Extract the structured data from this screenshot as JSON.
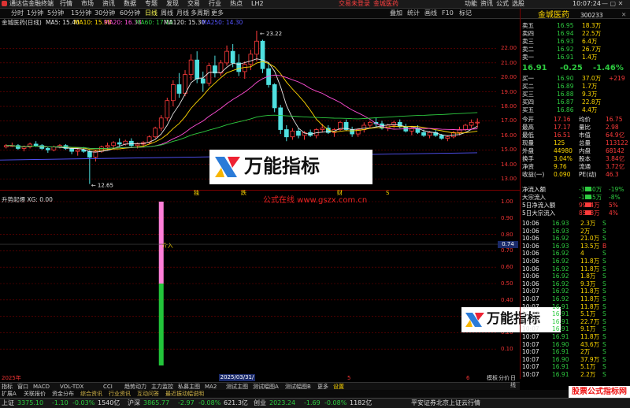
{
  "app": {
    "title": "通达信金融终端",
    "clock": "10:07:24"
  },
  "menu": [
    "行情",
    "市场",
    "资讯",
    "数据",
    "专题",
    "发现",
    "交易",
    "行业",
    "热点",
    "LH2"
  ],
  "menu_right": [
    "交易未登录",
    "金城医药"
  ],
  "menu_tail": [
    "功能",
    "资讯",
    "公式",
    "选股"
  ],
  "toolbar": [
    "分时",
    "1分钟",
    "5分钟",
    "15分钟",
    "30分钟",
    "60分钟",
    "日线",
    "周线",
    "月线",
    "多周期",
    "更多"
  ],
  "toolbar_right": [
    "叠加",
    "统计",
    "画线",
    "F10",
    "标记"
  ],
  "chart_title": "金城医药(日线)",
  "ma": [
    {
      "label": "MA5: 15.40",
      "color": "#e6e6e6"
    },
    {
      "label": "MA10: 15.98",
      "color": "#ffd800"
    },
    {
      "label": "MA20: 16.38",
      "color": "#ff4fd8"
    },
    {
      "label": "MA60: 17.19",
      "color": "#2ecc40"
    },
    {
      "label": "MA120: 15.30",
      "color": "#e6e6e6"
    },
    {
      "label": "MA250: 14.30",
      "color": "#5555ff"
    }
  ],
  "annotations": {
    "high": "23.22",
    "low": "12.65",
    "markers": [
      "独",
      "跌",
      "财",
      "S"
    ]
  },
  "price_axis": [
    "22.00",
    "21.00",
    "20.00",
    "19.00",
    "18.00",
    "17.00",
    "16.00",
    "15.00",
    "14.00",
    "13.00"
  ],
  "indicator": {
    "title": "升势起爆 XG: 0.00",
    "signal_label": "介入",
    "axis": [
      "1.00",
      "0.90",
      "0.80",
      "0.70",
      "0.60",
      "0.50",
      "0.40",
      "0.30",
      "0.20",
      "0.10"
    ],
    "cursor_value": "0.74"
  },
  "watermark": {
    "site": "公式在线 www.gszx.com.cn",
    "brand": "万能指标",
    "corner": "股票公式指标网"
  },
  "date_axis": {
    "left": "2025年",
    "cursor": "2025/03/31/一",
    "marks": [
      "5",
      "6"
    ]
  },
  "quote": {
    "name": "金城医药",
    "code": "300233",
    "price": "16.91",
    "change": "-0.25",
    "pct": "-1.46%",
    "asks": [
      [
        "卖五",
        "16.95",
        "18.3万"
      ],
      [
        "卖四",
        "16.94",
        "22.5万"
      ],
      [
        "卖三",
        "16.93",
        "6.4万"
      ],
      [
        "卖二",
        "16.92",
        "26.7万"
      ],
      [
        "卖一",
        "16.91",
        "1.4万"
      ]
    ],
    "bids": [
      [
        "买一",
        "16.90",
        "37.0万",
        "+219"
      ],
      [
        "买二",
        "16.89",
        "1.7万",
        ""
      ],
      [
        "买三",
        "16.88",
        "9.3万",
        ""
      ],
      [
        "买四",
        "16.87",
        "22.8万",
        ""
      ],
      [
        "买五",
        "16.86",
        "4.4万",
        ""
      ]
    ],
    "stats": [
      [
        "今开",
        "17.16",
        "均价",
        "16.75"
      ],
      [
        "最高",
        "17.17",
        "量比",
        "2.98"
      ],
      [
        "最低",
        "16.51",
        "市值",
        "64.9亿"
      ],
      [
        "现量",
        "125",
        "总量",
        "113122"
      ],
      [
        "外盘",
        "44980",
        "内盘",
        "68142"
      ],
      [
        "换手",
        "3.04%",
        "股本",
        "3.84亿"
      ],
      [
        "净资",
        "9.76",
        "流通",
        "3.72亿"
      ],
      [
        "收益(一)",
        "0.090",
        "PE(动)",
        "46.3"
      ]
    ],
    "flows": [
      [
        "净流入额",
        "-3640万",
        "-19%"
      ],
      [
        "大宗流入",
        "-1455万",
        "-8%"
      ],
      [
        "5日净流入额",
        "9924万",
        "5%"
      ],
      [
        "5日大宗流入",
        "8503万",
        "4%"
      ]
    ]
  },
  "ticks": [
    [
      "10:06",
      "16.93",
      "2.3万",
      "S"
    ],
    [
      "10:06",
      "16.93",
      "2万",
      "S"
    ],
    [
      "10:06",
      "16.92",
      "21.0万",
      "S"
    ],
    [
      "10:06",
      "16.93",
      "13.5万",
      "B"
    ],
    [
      "10:06",
      "16.92",
      "4",
      "S"
    ],
    [
      "10:06",
      "16.92",
      "11.8万",
      "S"
    ],
    [
      "10:06",
      "16.92",
      "11.8万",
      "S"
    ],
    [
      "10:06",
      "16.92",
      "1.8万",
      "S"
    ],
    [
      "10:06",
      "16.92",
      "9.3万",
      "S"
    ],
    [
      "10:07",
      "16.92",
      "11.8万",
      "S"
    ],
    [
      "10:07",
      "16.92",
      "11.8万",
      "S"
    ],
    [
      "10:07",
      "16.91",
      "11.8万",
      "S"
    ],
    [
      "10:07",
      "16.91",
      "5.1万",
      "S"
    ],
    [
      "10:07",
      "16.91",
      "22.7万",
      "S"
    ],
    [
      "10:07",
      "16.91",
      "9.1万",
      "S"
    ],
    [
      "10:07",
      "16.91",
      "11.8万",
      "S"
    ],
    [
      "10:07",
      "16.90",
      "43.6万",
      "S"
    ],
    [
      "10:07",
      "16.91",
      "2万",
      "S"
    ],
    [
      "10:07",
      "16.90",
      "37.9万",
      "S"
    ],
    [
      "10:07",
      "16.91",
      "5.1万",
      "S"
    ],
    [
      "10:07",
      "16.91",
      "2.2万",
      "S"
    ]
  ],
  "bottom_tabs": [
    "指标",
    "窗口",
    "MACD",
    "VOL-TDX",
    "CCI",
    "趋势动力",
    "主力监控",
    "私募主图",
    "MA2",
    "测试主图",
    "测试幅图A",
    "测试幅图B",
    "更多",
    "设置"
  ],
  "bottom_tabs2": [
    "扩展A",
    "关联报价",
    "资金分布",
    "综合资讯",
    "行业资讯",
    "互动问答",
    "最近振动幅说明"
  ],
  "right_tabs": [
    "模板",
    "分价",
    "日线"
  ],
  "status": [
    {
      "label": "上证",
      "value": "3375.10",
      "chg": "-1.10",
      "pct": "-0.03%",
      "vol": "1540亿"
    },
    {
      "label": "沪深",
      "value": "3865.77",
      "chg": "-2.97",
      "pct": "-0.08%",
      "vol": "621.3亿"
    },
    {
      "label": "创业",
      "value": "2023.24",
      "chg": "-1.69",
      "pct": "-0.08%",
      "vol": "1182亿"
    }
  ],
  "status_right": "平安证券北京上证云行情",
  "candles": [
    [
      15.2,
      15.4,
      15.1,
      15.3
    ],
    [
      15.3,
      15.5,
      15.2,
      15.3
    ],
    [
      15.3,
      15.4,
      15.0,
      15.1
    ],
    [
      15.1,
      15.3,
      14.9,
      15.2
    ],
    [
      15.2,
      15.5,
      15.1,
      15.4
    ],
    [
      15.4,
      15.6,
      15.2,
      15.3
    ],
    [
      15.3,
      15.4,
      15.0,
      15.1
    ],
    [
      15.1,
      15.2,
      14.8,
      15.0
    ],
    [
      15.0,
      15.3,
      14.9,
      15.2
    ],
    [
      15.2,
      15.4,
      15.1,
      15.3
    ],
    [
      15.3,
      15.4,
      15.0,
      15.1
    ],
    [
      15.1,
      15.2,
      14.7,
      14.9
    ],
    [
      14.9,
      15.1,
      14.6,
      15.0
    ],
    [
      15.0,
      15.2,
      14.8,
      14.9
    ],
    [
      14.9,
      15.0,
      12.65,
      14.5
    ],
    [
      14.5,
      15.0,
      14.2,
      14.9
    ],
    [
      14.9,
      15.3,
      14.8,
      15.2
    ],
    [
      15.2,
      15.5,
      15.0,
      15.3
    ],
    [
      15.3,
      15.6,
      15.1,
      15.5
    ],
    [
      15.5,
      15.8,
      15.2,
      15.4
    ],
    [
      15.4,
      15.7,
      15.3,
      15.6
    ],
    [
      15.6,
      15.8,
      15.2,
      15.3
    ],
    [
      15.3,
      15.5,
      15.1,
      15.4
    ],
    [
      15.4,
      15.6,
      15.2,
      15.5
    ],
    [
      15.5,
      16.0,
      15.4,
      15.9
    ],
    [
      15.9,
      16.6,
      15.8,
      16.5
    ],
    [
      16.5,
      17.4,
      16.3,
      17.2
    ],
    [
      17.2,
      18.6,
      17.0,
      18.4
    ],
    [
      18.4,
      19.8,
      18.0,
      19.5
    ],
    [
      19.5,
      20.3,
      18.6,
      18.9
    ],
    [
      18.9,
      20.5,
      18.7,
      20.2
    ],
    [
      20.2,
      21.6,
      19.8,
      21.2
    ],
    [
      21.2,
      21.8,
      19.6,
      19.9
    ],
    [
      19.9,
      20.4,
      19.0,
      19.6
    ],
    [
      19.6,
      21.0,
      19.4,
      20.8
    ],
    [
      20.8,
      21.5,
      20.0,
      20.3
    ],
    [
      20.3,
      21.2,
      20.1,
      21.0
    ],
    [
      21.0,
      22.2,
      20.8,
      21.8
    ],
    [
      21.8,
      22.3,
      20.7,
      21.0
    ],
    [
      21.0,
      21.6,
      20.1,
      20.4
    ],
    [
      20.4,
      21.1,
      19.9,
      20.9
    ],
    [
      20.9,
      21.9,
      20.5,
      21.6
    ],
    [
      21.6,
      23.22,
      21.1,
      22.5
    ],
    [
      22.5,
      22.6,
      20.3,
      20.6
    ],
    [
      20.6,
      21.0,
      19.3,
      19.5
    ],
    [
      19.5,
      19.6,
      17.6,
      17.9
    ],
    [
      17.9,
      18.1,
      16.1,
      16.4
    ],
    [
      16.4,
      16.7,
      15.6,
      15.9
    ],
    [
      15.9,
      16.5,
      15.7,
      16.3
    ],
    [
      16.3,
      16.5,
      15.8,
      16.0
    ],
    [
      16.0,
      16.3,
      15.7,
      16.2
    ],
    [
      16.2,
      16.4,
      15.9,
      16.0
    ],
    [
      16.0,
      16.5,
      15.8,
      16.4
    ],
    [
      16.4,
      16.8,
      16.2,
      16.5
    ],
    [
      16.5,
      16.7,
      16.1,
      16.2
    ],
    [
      16.2,
      16.5,
      15.9,
      16.4
    ],
    [
      16.4,
      17.0,
      16.3,
      16.9
    ],
    [
      16.9,
      17.1,
      16.3,
      16.4
    ],
    [
      16.4,
      16.6,
      15.9,
      16.1
    ],
    [
      16.1,
      16.5,
      15.9,
      16.4
    ],
    [
      16.4,
      16.9,
      16.2,
      16.7
    ],
    [
      16.7,
      17.0,
      16.5,
      16.9
    ],
    [
      16.9,
      17.2,
      16.6,
      16.8
    ],
    [
      16.8,
      17.0,
      16.4,
      16.5
    ],
    [
      16.5,
      16.8,
      16.3,
      16.7
    ],
    [
      16.7,
      17.0,
      16.5,
      16.9
    ],
    [
      16.9,
      17.1,
      16.5,
      16.6
    ],
    [
      16.6,
      16.8,
      16.2,
      16.3
    ],
    [
      16.3,
      16.6,
      16.0,
      16.5
    ],
    [
      16.5,
      16.7,
      16.1,
      16.2
    ],
    [
      16.2,
      16.4,
      15.9,
      16.0
    ],
    [
      16.0,
      16.3,
      15.8,
      16.2
    ],
    [
      16.2,
      16.4,
      15.9,
      16.0
    ],
    [
      16.0,
      16.1,
      15.7,
      15.8
    ],
    [
      15.8,
      16.0,
      15.6,
      15.9
    ],
    [
      15.9,
      16.3,
      15.8,
      16.2
    ],
    [
      16.2,
      16.6,
      16.0,
      16.4
    ],
    [
      16.4,
      16.8,
      16.3,
      16.7
    ],
    [
      16.7,
      17.1,
      16.5,
      16.9
    ],
    [
      16.9,
      17.17,
      16.51,
      16.91
    ]
  ],
  "signal_index": 26
}
